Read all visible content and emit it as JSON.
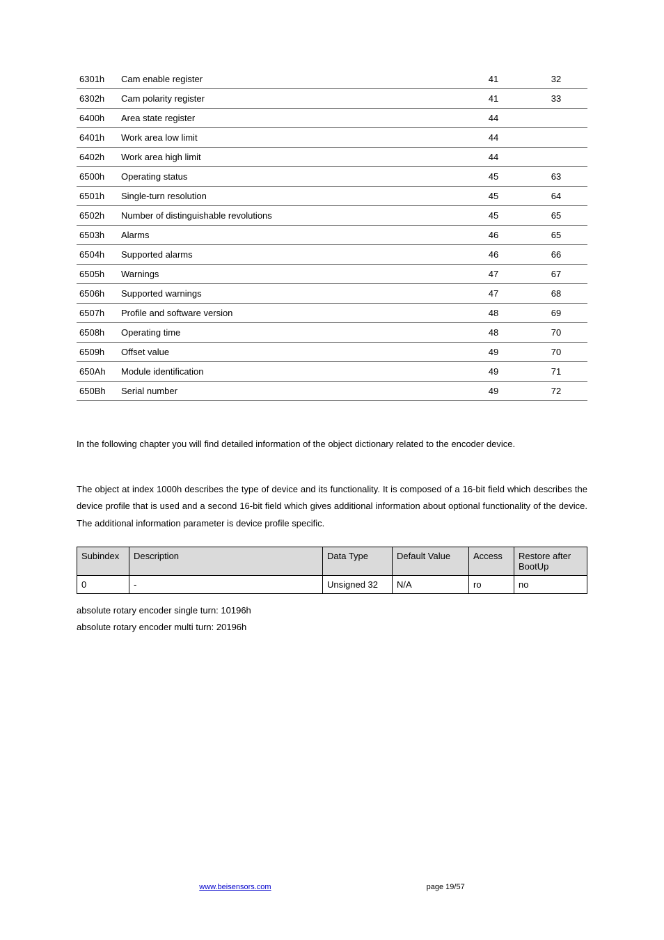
{
  "obj_table": {
    "rows": [
      {
        "code": "6301h",
        "desc": "Cam enable register",
        "c1": "41",
        "c2": "32"
      },
      {
        "code": "6302h",
        "desc": "Cam polarity register",
        "c1": "41",
        "c2": "33"
      },
      {
        "code": "6400h",
        "desc": "Area state register",
        "c1": "44",
        "c2": ""
      },
      {
        "code": "6401h",
        "desc": "Work area low limit",
        "c1": "44",
        "c2": ""
      },
      {
        "code": "6402h",
        "desc": "Work area high limit",
        "c1": "44",
        "c2": ""
      },
      {
        "code": "6500h",
        "desc": "Operating status",
        "c1": "45",
        "c2": "63"
      },
      {
        "code": "6501h",
        "desc": "Single-turn resolution",
        "c1": "45",
        "c2": "64"
      },
      {
        "code": "6502h",
        "desc": "Number of distinguishable revolutions",
        "c1": "45",
        "c2": "65"
      },
      {
        "code": "6503h",
        "desc": "Alarms",
        "c1": "46",
        "c2": "65"
      },
      {
        "code": "6504h",
        "desc": "Supported alarms",
        "c1": "46",
        "c2": "66"
      },
      {
        "code": "6505h",
        "desc": "Warnings",
        "c1": "47",
        "c2": "67"
      },
      {
        "code": "6506h",
        "desc": "Supported warnings",
        "c1": "47",
        "c2": "68"
      },
      {
        "code": "6507h",
        "desc": "Profile and software version",
        "c1": "48",
        "c2": "69"
      },
      {
        "code": "6508h",
        "desc": "Operating time",
        "c1": "48",
        "c2": "70"
      },
      {
        "code": "6509h",
        "desc": "Offset value",
        "c1": "49",
        "c2": "70"
      },
      {
        "code": "650Ah",
        "desc": "Module identification",
        "c1": "49",
        "c2": "71"
      },
      {
        "code": "650Bh",
        "desc": "Serial number",
        "c1": "49",
        "c2": "72"
      }
    ]
  },
  "para1": "In the following chapter you will find detailed information of the object dictionary related to the encoder device.",
  "para2": "The object at index 1000h describes the type of device and its functionality. It is composed of a 16-bit field which describes the device profile that is used and a second 16-bit field which gives additional information about optional functionality of the device. The additional information parameter is device profile specific.",
  "def_table": {
    "headers": {
      "h0": "Subindex",
      "h1": "Description",
      "h2": "Data Type",
      "h3": "Default Value",
      "h4": "Access",
      "h5": "Restore after BootUp"
    },
    "row": {
      "c0": "0",
      "c1": "-",
      "c2": "Unsigned 32",
      "c3": "N/A",
      "c4": "ro",
      "c5": "no"
    }
  },
  "notes": {
    "n1": "absolute rotary encoder single turn: 10196h",
    "n2": "absolute rotary encoder multi turn: 20196h"
  },
  "footer": {
    "link": "www.beisensors.com",
    "page": "page 19/57"
  }
}
